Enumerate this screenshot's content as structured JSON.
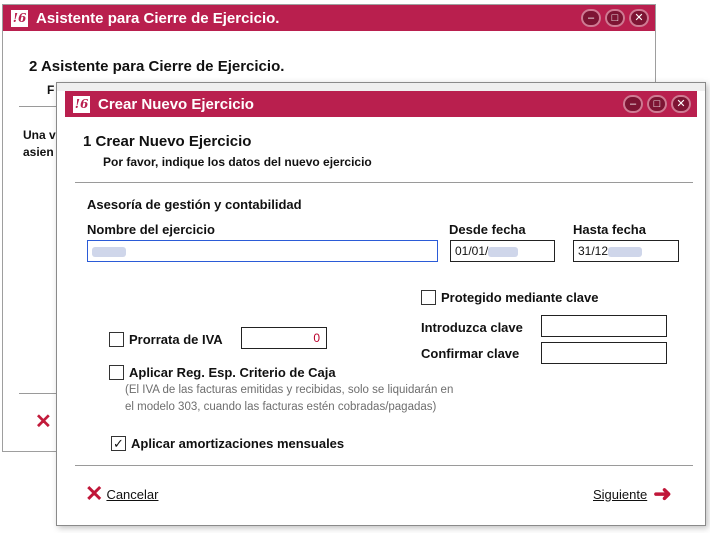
{
  "back_window": {
    "title": "Asistente para Cierre de Ejercicio.",
    "step_title": "2 Asistente para Cierre de Ejercicio.",
    "step_subtitle": "F",
    "body_text_line1": "Una v",
    "body_text_line2": "asien"
  },
  "front_window": {
    "title": "Crear Nuevo Ejercicio",
    "step_title": "1 Crear Nuevo Ejercicio",
    "step_subtitle": "Por favor, indique los datos del nuevo ejercicio",
    "company": "Asesoría de gestión y contabilidad",
    "labels": {
      "nombre": "Nombre del ejercicio",
      "desde": "Desde fecha",
      "hasta": "Hasta fecha",
      "protegido": "Protegido mediante clave",
      "prorrata": "Prorrata de IVA",
      "introduzca": "Introduzca clave",
      "confirmar": "Confirmar clave",
      "criterio_caja": "Aplicar Reg. Esp. Criterio de Caja",
      "amortizaciones": "Aplicar amortizaciones mensuales"
    },
    "values": {
      "nombre": "",
      "desde_prefix": "01/01/",
      "hasta_prefix": "31/12",
      "prorrata": "0",
      "introduzca": "",
      "confirmar": ""
    },
    "checkboxes": {
      "protegido": false,
      "prorrata": false,
      "criterio_caja": false,
      "amortizaciones": true
    },
    "hint_line1": "(El IVA de las facturas emitidas y recibidas, solo se liquidarán en",
    "hint_line2": "el modelo 303, cuando las facturas estén cobradas/pagadas)",
    "buttons": {
      "cancel": "Cancelar",
      "next": "Siguiente"
    }
  },
  "colors": {
    "titlebar": "#b91f4e",
    "accent_red": "#c01739",
    "focus_border": "#2b5bd7"
  }
}
